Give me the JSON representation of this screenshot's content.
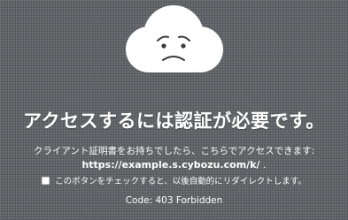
{
  "illustration": {
    "icon": "sad-cloud-icon"
  },
  "error": {
    "headline": "アクセスするには認証が必要です。",
    "cert_message": "クライアント証明書をお持ちでしたら、こちらでアクセスできます:",
    "url": "https://example.s.cybozu.com/k/",
    "url_suffix": " .",
    "checkbox_label": "このボタンをチェックすると、以後自動的にリダイレクトします。",
    "code": "Code: 403 Forbidden"
  },
  "colors": {
    "background": "#5e6266",
    "text": "#ffffff",
    "cloud": "#ffffff",
    "face": "#3b3b3b"
  }
}
